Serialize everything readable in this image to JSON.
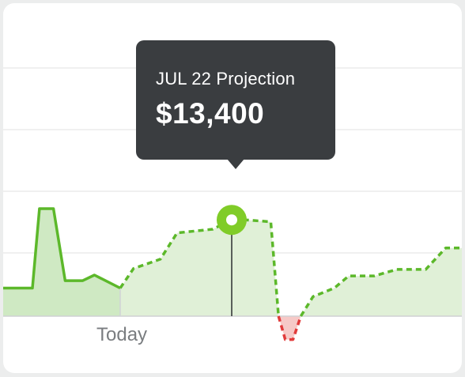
{
  "chart_data": {
    "type": "area",
    "marker_label": "Today",
    "tooltip": {
      "label": "JUL 22 Projection",
      "value": "$13,400"
    },
    "y_baseline": 0,
    "ylim": [
      -2500,
      24000
    ],
    "grid": true,
    "colors": {
      "actual_line": "#5cb82a",
      "actual_fill": "#cfe9c3",
      "projection_line": "#5cb82a",
      "projection_fill": "#e0f0d7",
      "negative_line": "#e13b3b",
      "negative_fill": "#f6c9c7",
      "highlight_point": "#80cc28"
    },
    "series": [
      {
        "values": [
          [
            0,
            3000
          ],
          [
            0.25,
            3000
          ],
          [
            0.31,
            11500
          ],
          [
            0.43,
            11500
          ],
          [
            0.53,
            3800
          ],
          [
            0.68,
            3800
          ],
          [
            0.78,
            4400
          ],
          [
            1,
            3000
          ]
        ]
      },
      {
        "values": [
          [
            1,
            3000
          ],
          [
            1.12,
            5100
          ],
          [
            1.36,
            6100
          ],
          [
            1.51,
            8900
          ],
          [
            1.83,
            9300
          ],
          [
            2,
            10300
          ],
          [
            2.12,
            10300
          ],
          [
            2.35,
            10100
          ],
          [
            2.42,
            0
          ],
          [
            2.48,
            -2500
          ],
          [
            2.55,
            -2500
          ],
          [
            2.62,
            0
          ],
          [
            2.73,
            2100
          ],
          [
            2.92,
            3000
          ],
          [
            3.05,
            4300
          ],
          [
            3.28,
            4300
          ],
          [
            3.48,
            5000
          ],
          [
            3.74,
            5000
          ],
          [
            3.92,
            7300
          ],
          [
            4.18,
            7300
          ]
        ]
      }
    ],
    "highlight": {
      "x": 2,
      "y": 10300
    }
  }
}
